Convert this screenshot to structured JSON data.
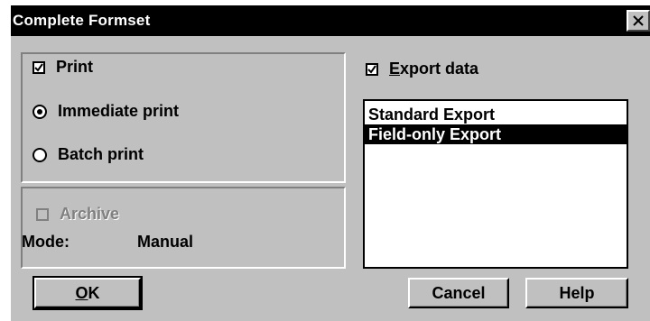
{
  "window": {
    "title": "Complete Formset"
  },
  "print_group": {
    "print_label": "Print",
    "print_checked": true,
    "immediate_label": "Immediate print",
    "batch_label": "Batch print",
    "selected_mode": "Immediate print"
  },
  "archive_group": {
    "archive_label": "Archive",
    "archive_enabled": false,
    "mode_label": "Mode:",
    "mode_value": "Manual"
  },
  "export": {
    "export_label": "Export data",
    "export_checked": true,
    "options": [
      "Standard Export",
      "Field-only Export"
    ],
    "selected": "Field-only Export"
  },
  "buttons": {
    "ok": "OK",
    "cancel": "Cancel",
    "help": "Help"
  }
}
